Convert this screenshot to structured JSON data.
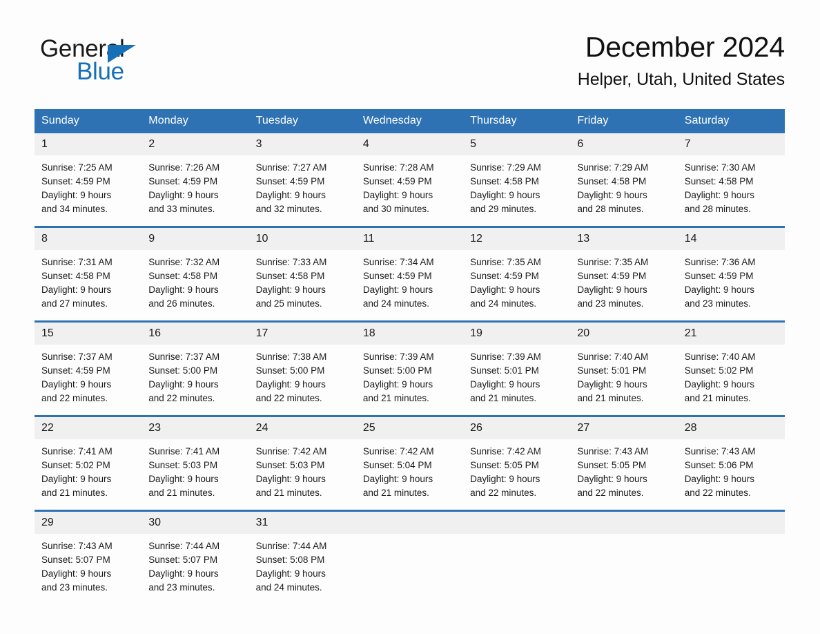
{
  "brand": {
    "name_part1": "General",
    "name_part2": "Blue",
    "accent_color": "#1670b8"
  },
  "header": {
    "month_title": "December 2024",
    "location": "Helper, Utah, United States"
  },
  "theme": {
    "header_blue": "#2e72b4",
    "daynum_band": "#f0f0f0",
    "page_bg": "#fdfdfd"
  },
  "weekday_headers": [
    "Sunday",
    "Monday",
    "Tuesday",
    "Wednesday",
    "Thursday",
    "Friday",
    "Saturday"
  ],
  "weeks": [
    {
      "days": [
        {
          "num": "1",
          "l1": "Sunrise: 7:25 AM",
          "l2": "Sunset: 4:59 PM",
          "l3": "Daylight: 9 hours",
          "l4": "and 34 minutes."
        },
        {
          "num": "2",
          "l1": "Sunrise: 7:26 AM",
          "l2": "Sunset: 4:59 PM",
          "l3": "Daylight: 9 hours",
          "l4": "and 33 minutes."
        },
        {
          "num": "3",
          "l1": "Sunrise: 7:27 AM",
          "l2": "Sunset: 4:59 PM",
          "l3": "Daylight: 9 hours",
          "l4": "and 32 minutes."
        },
        {
          "num": "4",
          "l1": "Sunrise: 7:28 AM",
          "l2": "Sunset: 4:59 PM",
          "l3": "Daylight: 9 hours",
          "l4": "and 30 minutes."
        },
        {
          "num": "5",
          "l1": "Sunrise: 7:29 AM",
          "l2": "Sunset: 4:58 PM",
          "l3": "Daylight: 9 hours",
          "l4": "and 29 minutes."
        },
        {
          "num": "6",
          "l1": "Sunrise: 7:29 AM",
          "l2": "Sunset: 4:58 PM",
          "l3": "Daylight: 9 hours",
          "l4": "and 28 minutes."
        },
        {
          "num": "7",
          "l1": "Sunrise: 7:30 AM",
          "l2": "Sunset: 4:58 PM",
          "l3": "Daylight: 9 hours",
          "l4": "and 28 minutes."
        }
      ]
    },
    {
      "days": [
        {
          "num": "8",
          "l1": "Sunrise: 7:31 AM",
          "l2": "Sunset: 4:58 PM",
          "l3": "Daylight: 9 hours",
          "l4": "and 27 minutes."
        },
        {
          "num": "9",
          "l1": "Sunrise: 7:32 AM",
          "l2": "Sunset: 4:58 PM",
          "l3": "Daylight: 9 hours",
          "l4": "and 26 minutes."
        },
        {
          "num": "10",
          "l1": "Sunrise: 7:33 AM",
          "l2": "Sunset: 4:58 PM",
          "l3": "Daylight: 9 hours",
          "l4": "and 25 minutes."
        },
        {
          "num": "11",
          "l1": "Sunrise: 7:34 AM",
          "l2": "Sunset: 4:59 PM",
          "l3": "Daylight: 9 hours",
          "l4": "and 24 minutes."
        },
        {
          "num": "12",
          "l1": "Sunrise: 7:35 AM",
          "l2": "Sunset: 4:59 PM",
          "l3": "Daylight: 9 hours",
          "l4": "and 24 minutes."
        },
        {
          "num": "13",
          "l1": "Sunrise: 7:35 AM",
          "l2": "Sunset: 4:59 PM",
          "l3": "Daylight: 9 hours",
          "l4": "and 23 minutes."
        },
        {
          "num": "14",
          "l1": "Sunrise: 7:36 AM",
          "l2": "Sunset: 4:59 PM",
          "l3": "Daylight: 9 hours",
          "l4": "and 23 minutes."
        }
      ]
    },
    {
      "days": [
        {
          "num": "15",
          "l1": "Sunrise: 7:37 AM",
          "l2": "Sunset: 4:59 PM",
          "l3": "Daylight: 9 hours",
          "l4": "and 22 minutes."
        },
        {
          "num": "16",
          "l1": "Sunrise: 7:37 AM",
          "l2": "Sunset: 5:00 PM",
          "l3": "Daylight: 9 hours",
          "l4": "and 22 minutes."
        },
        {
          "num": "17",
          "l1": "Sunrise: 7:38 AM",
          "l2": "Sunset: 5:00 PM",
          "l3": "Daylight: 9 hours",
          "l4": "and 22 minutes."
        },
        {
          "num": "18",
          "l1": "Sunrise: 7:39 AM",
          "l2": "Sunset: 5:00 PM",
          "l3": "Daylight: 9 hours",
          "l4": "and 21 minutes."
        },
        {
          "num": "19",
          "l1": "Sunrise: 7:39 AM",
          "l2": "Sunset: 5:01 PM",
          "l3": "Daylight: 9 hours",
          "l4": "and 21 minutes."
        },
        {
          "num": "20",
          "l1": "Sunrise: 7:40 AM",
          "l2": "Sunset: 5:01 PM",
          "l3": "Daylight: 9 hours",
          "l4": "and 21 minutes."
        },
        {
          "num": "21",
          "l1": "Sunrise: 7:40 AM",
          "l2": "Sunset: 5:02 PM",
          "l3": "Daylight: 9 hours",
          "l4": "and 21 minutes."
        }
      ]
    },
    {
      "days": [
        {
          "num": "22",
          "l1": "Sunrise: 7:41 AM",
          "l2": "Sunset: 5:02 PM",
          "l3": "Daylight: 9 hours",
          "l4": "and 21 minutes."
        },
        {
          "num": "23",
          "l1": "Sunrise: 7:41 AM",
          "l2": "Sunset: 5:03 PM",
          "l3": "Daylight: 9 hours",
          "l4": "and 21 minutes."
        },
        {
          "num": "24",
          "l1": "Sunrise: 7:42 AM",
          "l2": "Sunset: 5:03 PM",
          "l3": "Daylight: 9 hours",
          "l4": "and 21 minutes."
        },
        {
          "num": "25",
          "l1": "Sunrise: 7:42 AM",
          "l2": "Sunset: 5:04 PM",
          "l3": "Daylight: 9 hours",
          "l4": "and 21 minutes."
        },
        {
          "num": "26",
          "l1": "Sunrise: 7:42 AM",
          "l2": "Sunset: 5:05 PM",
          "l3": "Daylight: 9 hours",
          "l4": "and 22 minutes."
        },
        {
          "num": "27",
          "l1": "Sunrise: 7:43 AM",
          "l2": "Sunset: 5:05 PM",
          "l3": "Daylight: 9 hours",
          "l4": "and 22 minutes."
        },
        {
          "num": "28",
          "l1": "Sunrise: 7:43 AM",
          "l2": "Sunset: 5:06 PM",
          "l3": "Daylight: 9 hours",
          "l4": "and 22 minutes."
        }
      ]
    },
    {
      "days": [
        {
          "num": "29",
          "l1": "Sunrise: 7:43 AM",
          "l2": "Sunset: 5:07 PM",
          "l3": "Daylight: 9 hours",
          "l4": "and 23 minutes."
        },
        {
          "num": "30",
          "l1": "Sunrise: 7:44 AM",
          "l2": "Sunset: 5:07 PM",
          "l3": "Daylight: 9 hours",
          "l4": "and 23 minutes."
        },
        {
          "num": "31",
          "l1": "Sunrise: 7:44 AM",
          "l2": "Sunset: 5:08 PM",
          "l3": "Daylight: 9 hours",
          "l4": "and 24 minutes."
        },
        {
          "num": "",
          "l1": "",
          "l2": "",
          "l3": "",
          "l4": ""
        },
        {
          "num": "",
          "l1": "",
          "l2": "",
          "l3": "",
          "l4": ""
        },
        {
          "num": "",
          "l1": "",
          "l2": "",
          "l3": "",
          "l4": ""
        },
        {
          "num": "",
          "l1": "",
          "l2": "",
          "l3": "",
          "l4": ""
        }
      ]
    }
  ]
}
